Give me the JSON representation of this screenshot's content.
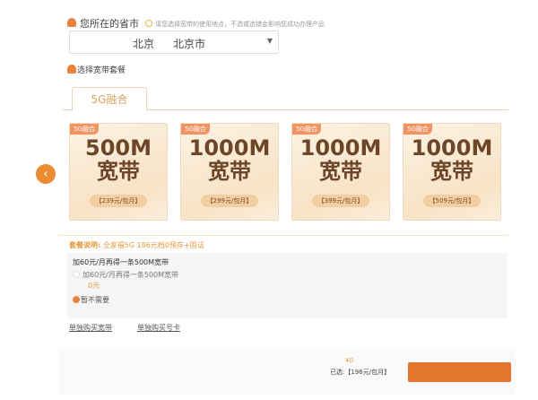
{
  "location": {
    "label": "您所在的省市",
    "hint": "请您选择宽带的使用地点，不选或选错会影响您成功办理产品",
    "province": "北京",
    "city": "北京市"
  },
  "package": {
    "label": "选择宽带套餐",
    "tab": "5G融合"
  },
  "cards": [
    {
      "badge": "5G融合",
      "speed": "500M",
      "type": "宽带",
      "price": "【239元/包月】"
    },
    {
      "badge": "5G融合",
      "speed": "1000M",
      "type": "宽带",
      "price": "【299元/包月】"
    },
    {
      "badge": "5G融合",
      "speed": "1000M",
      "type": "宽带",
      "price": "【399元/包月】"
    },
    {
      "badge": "5G融合",
      "speed": "1000M",
      "type": "宽带",
      "price": "【509元/包月】"
    }
  ],
  "desc": {
    "label": "套餐说明:",
    "text": "全家福5G 196元档0预存+固话"
  },
  "addon": {
    "title": "加60元/月再得一条500M宽带",
    "option": "加60元/月再得一条500M宽带",
    "option_price": "0元",
    "none": "暂不需要"
  },
  "links": {
    "broadband": "单独购买宽带",
    "sim": "单独购买号卡"
  },
  "footer": {
    "total": "¥0",
    "selected": "已选:【196元/包月】"
  },
  "colors": {
    "accent": "#e9823a"
  }
}
